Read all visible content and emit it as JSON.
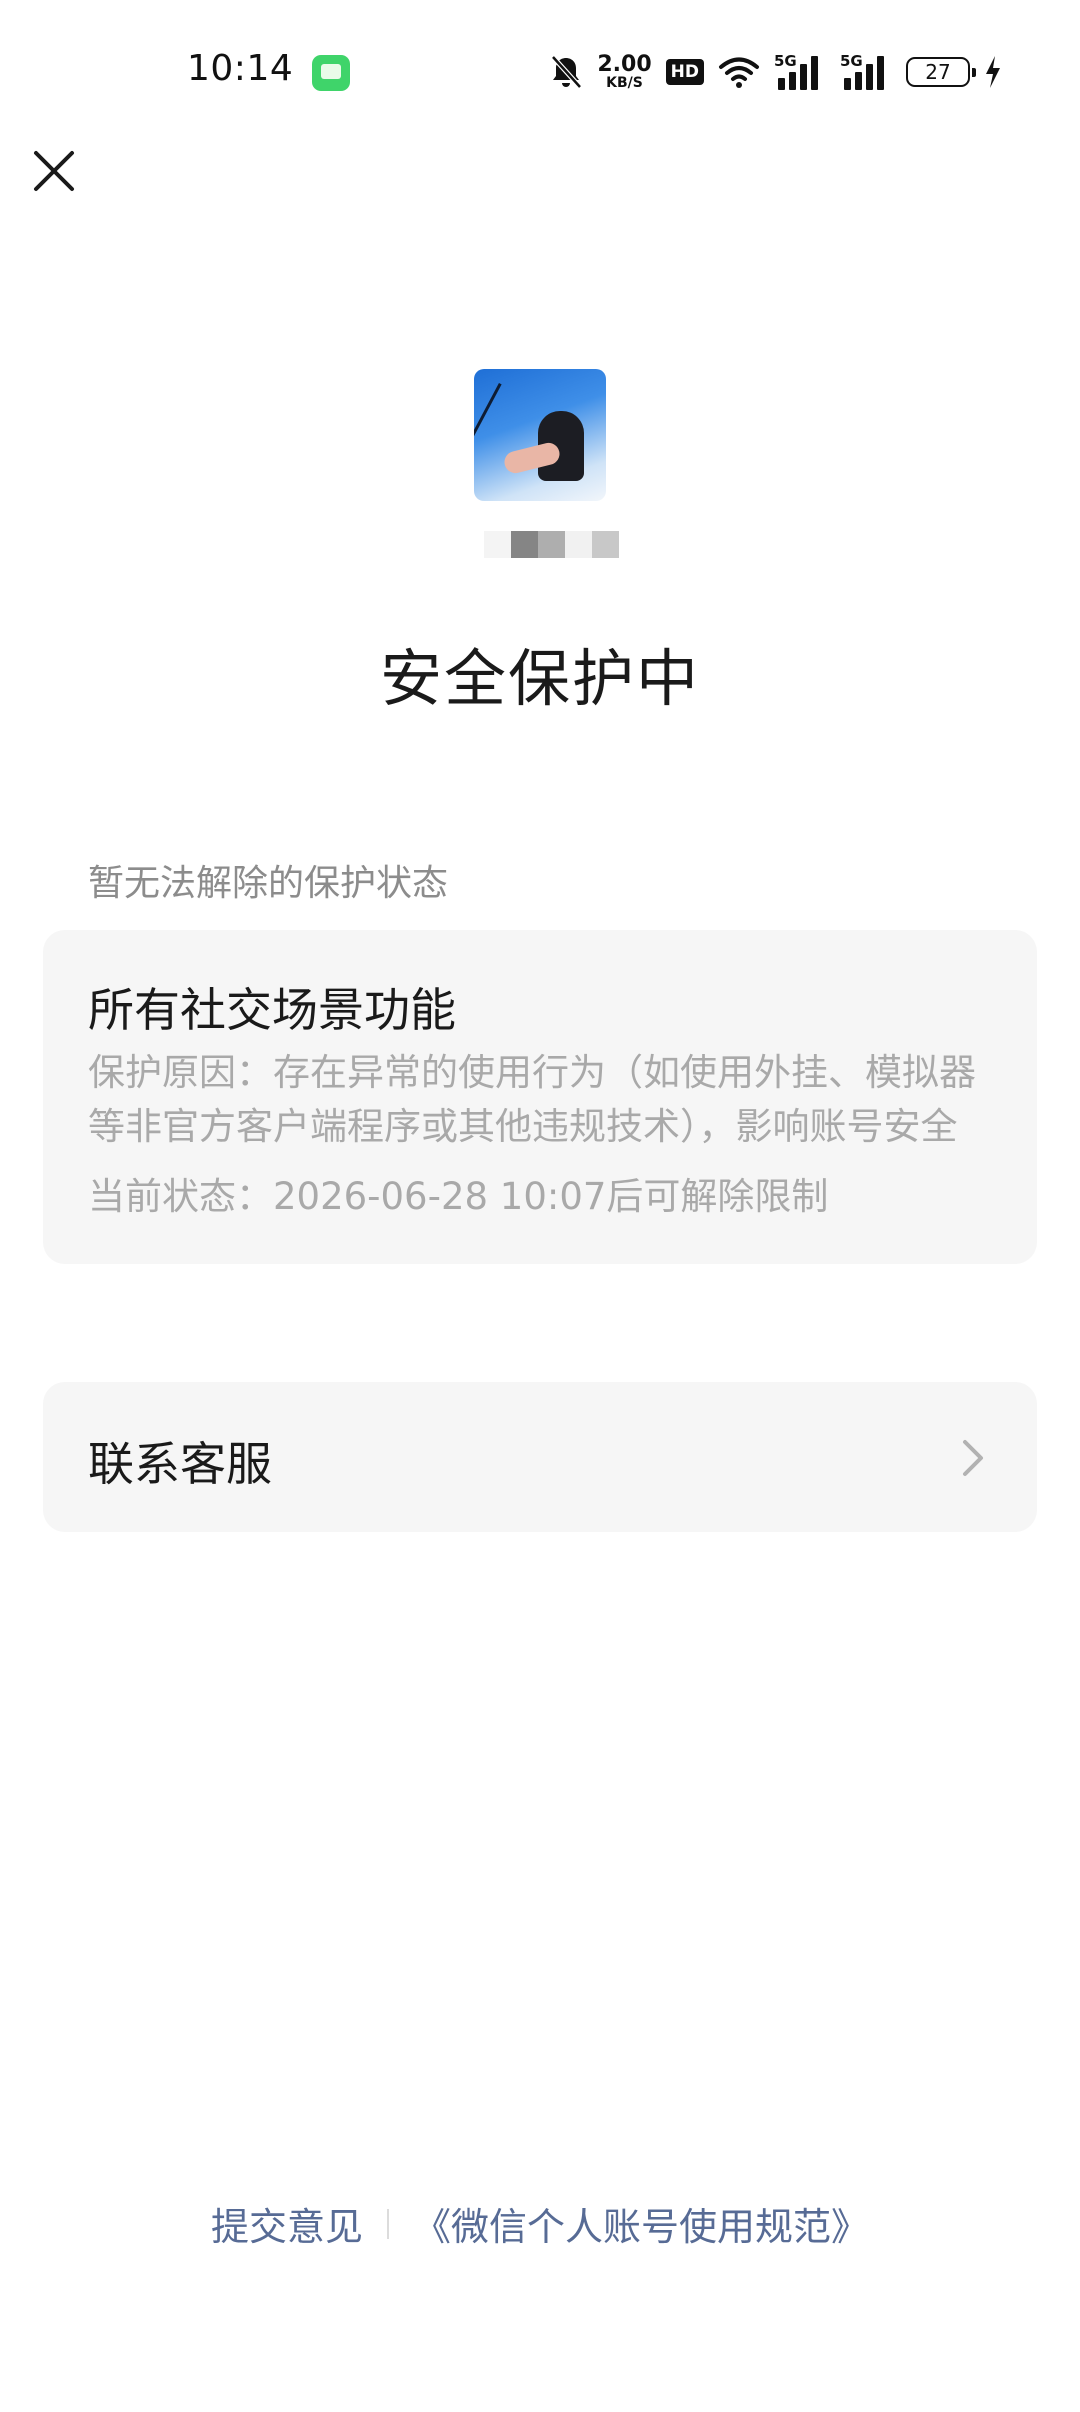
{
  "status_bar": {
    "time": "10:14",
    "net_speed_value": "2.00",
    "net_speed_unit": "KB/S",
    "hd_label": "HD",
    "sim1_label": "5G",
    "sim2_label": "5G",
    "battery_level": "27"
  },
  "account": {
    "avatar_icon": "user-photo",
    "title": "安全保护中"
  },
  "protection": {
    "section_label": "暂无法解除的保护状态",
    "item_title": "所有社交场景功能",
    "reason": "保护原因：存在异常的使用行为（如使用外挂、模拟器等非官方客户端程序或其他违规技术），影响账号安全",
    "status": "当前状态：2026-06-28 10:07后可解除限制"
  },
  "contact": {
    "label": "联系客服"
  },
  "footer": {
    "feedback_link": "提交意见",
    "policy_link": "《微信个人账号使用规范》"
  },
  "colors": {
    "link": "#576b95",
    "card_bg": "#f6f6f6",
    "muted_text": "#a9a9a9",
    "app_icon": "#3fd46a"
  }
}
